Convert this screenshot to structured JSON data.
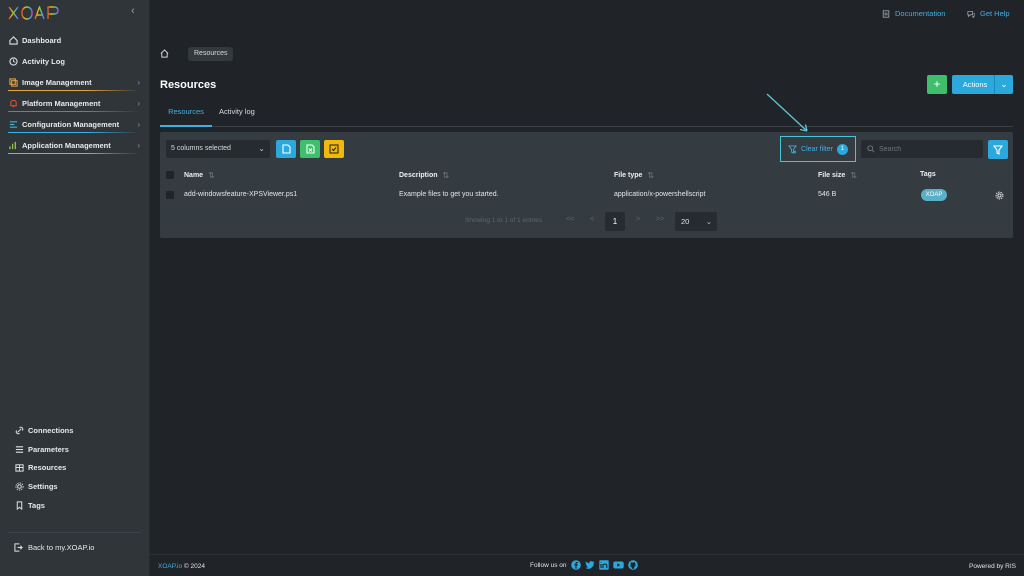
{
  "sidebar": {
    "logo": {
      "letters": [
        "X",
        "O",
        "A",
        "P"
      ],
      "colors": [
        "#ffffff",
        "#ffffff",
        "#ffffff",
        "#ffffff"
      ]
    },
    "nav": [
      {
        "label": "Dashboard",
        "icon": "home-icon",
        "has_chevron": false,
        "underline": ""
      },
      {
        "label": "Activity Log",
        "icon": "clock-icon",
        "has_chevron": false,
        "underline": ""
      },
      {
        "label": "Image Management",
        "icon": "image-icon",
        "has_chevron": true,
        "underline": "#e6a23c"
      },
      {
        "label": "Platform Management",
        "icon": "bell-icon",
        "has_chevron": true,
        "underline": "#e0562f"
      },
      {
        "label": "Configuration Management",
        "icon": "config-icon",
        "has_chevron": true,
        "underline": "#3fb0e3"
      },
      {
        "label": "Application Management",
        "icon": "app-icon",
        "has_chevron": true,
        "underline": "#8bc34a"
      }
    ],
    "bottom_nav": [
      {
        "label": "Connections",
        "icon": "link-icon"
      },
      {
        "label": "Parameters",
        "icon": "list-icon"
      },
      {
        "label": "Resources",
        "icon": "folder-icon"
      },
      {
        "label": "Settings",
        "icon": "gear-icon"
      },
      {
        "label": "Tags",
        "icon": "bookmark-icon"
      }
    ],
    "back_link": "Back to my.XOAP.io"
  },
  "header": {
    "documentation": "Documentation",
    "get_help": "Get Help"
  },
  "breadcrumb": {
    "current": "Resources"
  },
  "page": {
    "title": "Resources",
    "add_label": "+",
    "actions_label": "Actions"
  },
  "tabs": [
    {
      "label": "Resources",
      "active": true
    },
    {
      "label": "Activity log",
      "active": false
    }
  ],
  "toolbar": {
    "columns_selected": "5 columns selected",
    "clear_filter": "Clear filter",
    "filter_count": "1",
    "search_placeholder": "Search"
  },
  "table": {
    "columns": [
      "Name",
      "Description",
      "File type",
      "File size",
      "Tags"
    ],
    "rows": [
      {
        "name": "add-windowsfeature-XPSViewer.ps1",
        "description": "Example files to get you started.",
        "file_type": "application/x-powershellscript",
        "file_size": "546 B",
        "tag": "XOAP"
      }
    ]
  },
  "pagination": {
    "info": "Showing 1 to 1 of 1 entries",
    "first": "<<",
    "prev": "<",
    "page": "1",
    "next": ">",
    "last": ">>",
    "page_size": "20"
  },
  "footer": {
    "brand": "XOAP.io",
    "copyright": " © 2024",
    "follow": "Follow us on",
    "powered": "Powered by RIS"
  },
  "colors": {
    "accent": "#2ba8dc",
    "green": "#3fbf6b",
    "yellow": "#f0b90b",
    "sidebar_bg": "#2f3539",
    "page_bg": "#202428"
  }
}
